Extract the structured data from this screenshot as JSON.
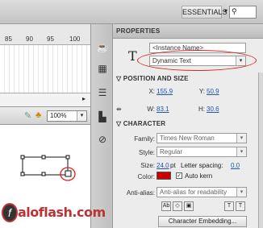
{
  "workspace": {
    "label": "ESSENTIALS",
    "search_placeholder": ""
  },
  "window_controls": {
    "minimize": "–",
    "maximize": "□",
    "close": "×"
  },
  "timeline": {
    "ticks": [
      "85",
      "90",
      "95",
      "100"
    ]
  },
  "stage": {
    "zoom": "100%"
  },
  "properties": {
    "tab": "PROPERTIES",
    "instance_name_placeholder": "<Instance Name>",
    "text_type": "Dynamic Text",
    "position_section": "POSITION AND SIZE",
    "x_label": "X:",
    "x_value": "155.9",
    "y_label": "Y:",
    "y_value": "50.9",
    "w_label": "W:",
    "w_value": "83.1",
    "h_label": "H:",
    "h_value": "30.6",
    "character_section": "CHARACTER",
    "family_label": "Family:",
    "family_value": "Times New Roman",
    "style_label": "Style:",
    "style_value": "Regular",
    "size_label": "Size:",
    "size_value": "24.0",
    "size_unit": "pt",
    "letter_spacing_label": "Letter spacing:",
    "letter_spacing_value": "0.0",
    "color_label": "Color:",
    "autokern_label": "Auto kern",
    "antialias_label": "Anti-alias:",
    "antialias_value": "Anti-alias for readability",
    "embed_button": "Character Embedding..."
  },
  "logo": {
    "text": "aloflash.com",
    "f": "f"
  },
  "colors": {
    "accent_red": "#cc0000",
    "link_blue": "#2255bb"
  }
}
